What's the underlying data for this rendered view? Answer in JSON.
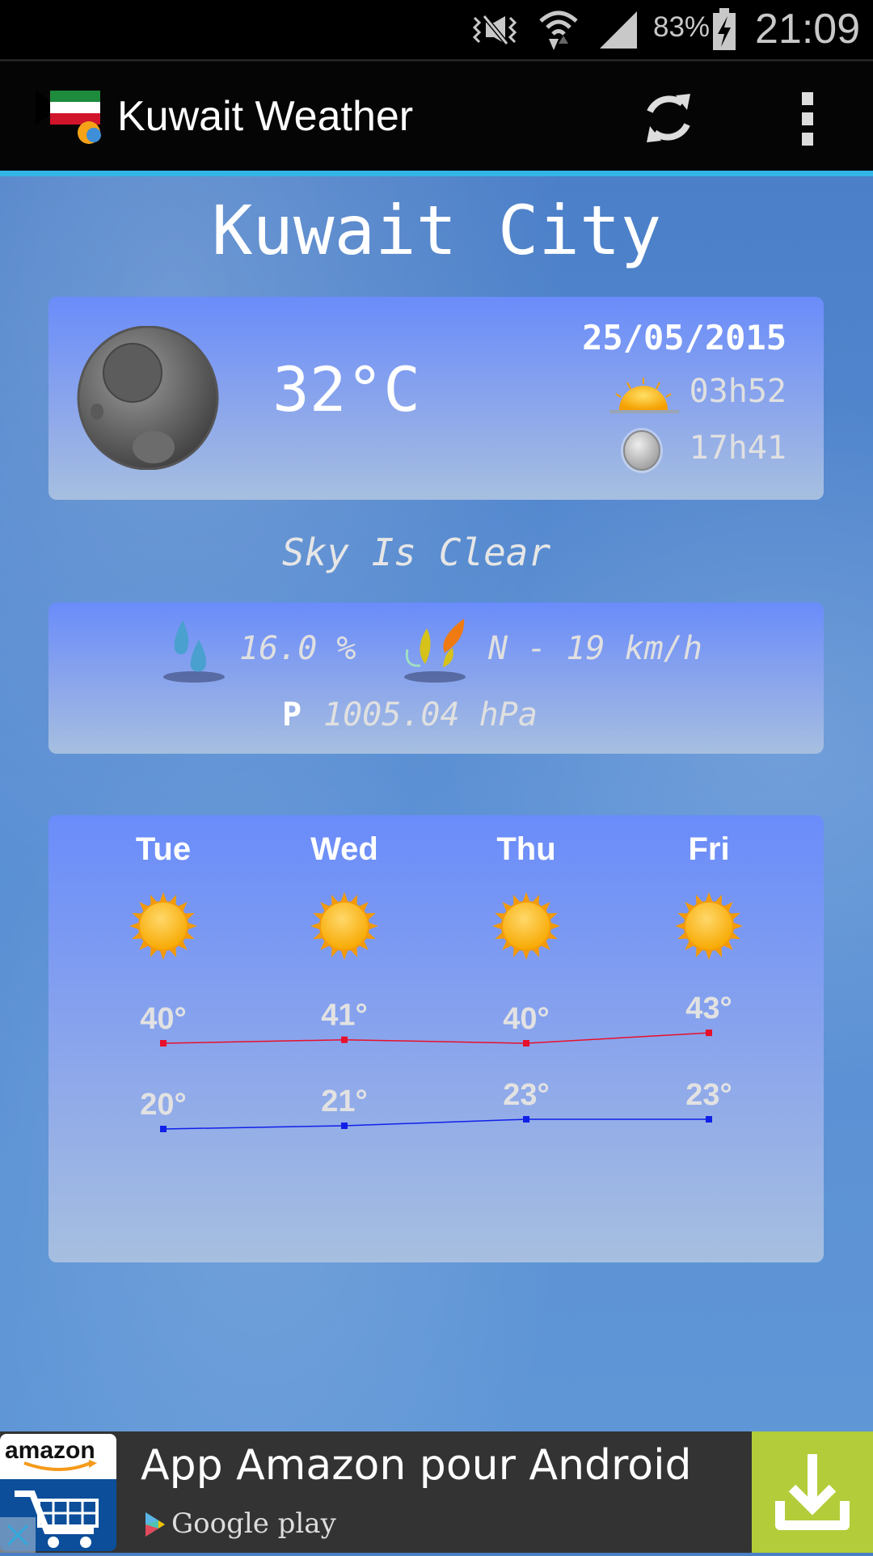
{
  "status_bar": {
    "battery": "83%",
    "time": "21:09",
    "icons": [
      "vibrate-mute-icon",
      "wifi-icon",
      "signal-icon",
      "battery-charging-icon"
    ]
  },
  "app_bar": {
    "title": "Kuwait Weather",
    "refresh_icon": "refresh-icon",
    "menu_icon": "overflow-menu-icon"
  },
  "city": "Kuwait City",
  "current": {
    "condition_icon": "moon-icon",
    "temperature": "32°C",
    "date": "25/05/2015",
    "sunrise": "03h52",
    "sunset": "17h41",
    "description": "Sky Is Clear"
  },
  "details": {
    "humidity": "16.0 %",
    "wind": "N - 19 km/h",
    "pressure_label": "P",
    "pressure": "1005.04 hPa"
  },
  "forecast": {
    "days": [
      {
        "day": "Tue",
        "high": 40,
        "low": 20,
        "high_label": "40°",
        "low_label": "20°",
        "icon": "sun-icon"
      },
      {
        "day": "Wed",
        "high": 41,
        "low": 21,
        "high_label": "41°",
        "low_label": "21°",
        "icon": "sun-icon"
      },
      {
        "day": "Thu",
        "high": 40,
        "low": 23,
        "high_label": "40°",
        "low_label": "23°",
        "icon": "sun-icon"
      },
      {
        "day": "Fri",
        "high": 43,
        "low": 23,
        "high_label": "43°",
        "low_label": "23°",
        "icon": "sun-icon"
      }
    ],
    "high_color": "#e8102a",
    "low_color": "#1020e8"
  },
  "ad": {
    "title": "App Amazon pour Android",
    "store": "Google play",
    "brand": "amazon",
    "accent": "#b3cc3a"
  }
}
